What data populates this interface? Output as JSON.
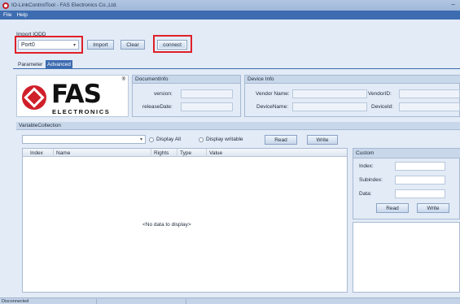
{
  "window": {
    "title": "IO-LinkControlTool - FAS Electronics Co.,Ltd.",
    "minimize_glyph": "–"
  },
  "menu": [
    "File",
    "Help"
  ],
  "import_group": {
    "title": "Import IODD",
    "port_value": "Port0",
    "import_label": "Import",
    "clear_label": "Clear",
    "connect_label": "connect"
  },
  "tabs": [
    {
      "label": "Parameter",
      "active": false
    },
    {
      "label": "Advanced",
      "active": true
    }
  ],
  "logo": {
    "text": "FAS",
    "subtext": "ELECTRONICS",
    "registered": "®"
  },
  "document_info": {
    "title": "DocumentInfo",
    "version_label": "version:",
    "version_value": "",
    "release_label": "releaseDate:",
    "release_value": ""
  },
  "device_info": {
    "title": "Device Info",
    "vendor_name_label": "Vendor Name:",
    "vendor_id_label": "VendorID:",
    "device_name_label": "DeviceName:",
    "device_id_label": "DeviceId:"
  },
  "variable_collection": {
    "title": "VariableCollection",
    "filter_value": "",
    "display_all_label": "Display All",
    "display_writable_label": "Display writable",
    "read_label": "Read",
    "write_label": "Write",
    "columns": [
      "Index",
      "Name",
      "Rights",
      "Type",
      "Value"
    ],
    "empty_text": "<No data to display>"
  },
  "custom": {
    "title": "Custom",
    "index_label": "Index:",
    "subindex_label": "Subindex:",
    "data_label": "Data:",
    "read_label": "Read",
    "write_label": "Write"
  },
  "status": {
    "text": "Disconnected"
  },
  "colors": {
    "accent": "#3d6cb0",
    "highlight_box": "#e0202a",
    "logo_red": "#d01f2a"
  }
}
